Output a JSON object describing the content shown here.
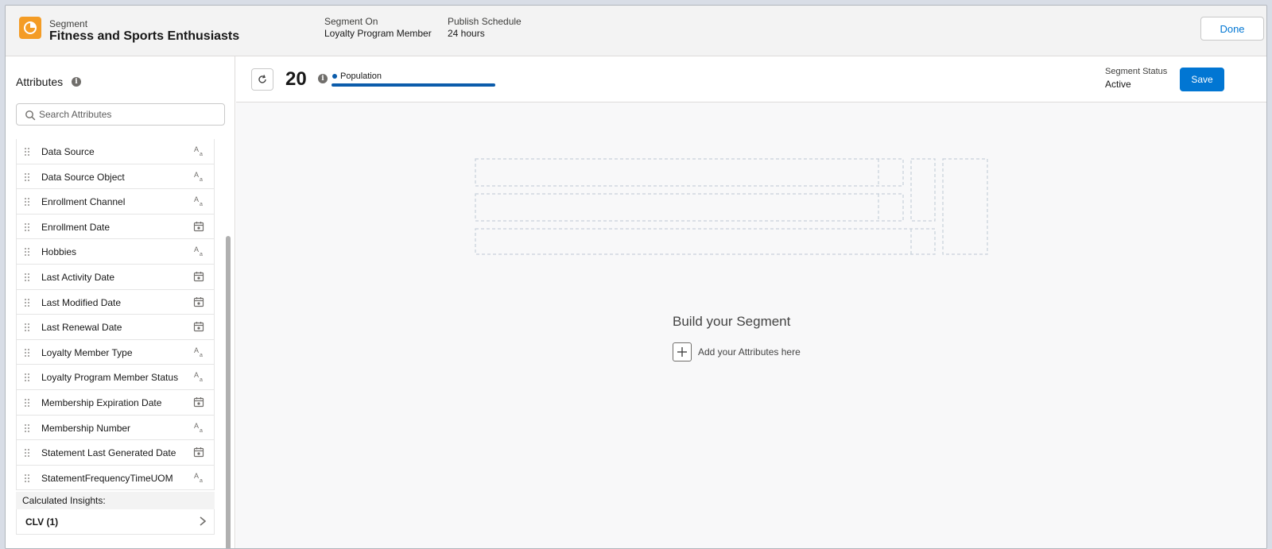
{
  "header": {
    "type_label": "Segment",
    "segment_name": "Fitness and Sports Enthusiasts",
    "segment_on_label": "Segment On",
    "segment_on_value": "Loyalty Program Member",
    "publish_label": "Publish Schedule",
    "publish_value": "24 hours",
    "done_label": "Done"
  },
  "sidebar": {
    "title": "Attributes",
    "search_placeholder": "Search Attributes",
    "items": [
      {
        "label": "Data Source",
        "type": "text"
      },
      {
        "label": "Data Source Object",
        "type": "text"
      },
      {
        "label": "Enrollment Channel",
        "type": "text"
      },
      {
        "label": "Enrollment Date",
        "type": "date"
      },
      {
        "label": "Hobbies",
        "type": "text"
      },
      {
        "label": "Last Activity Date",
        "type": "date"
      },
      {
        "label": "Last Modified Date",
        "type": "date"
      },
      {
        "label": "Last Renewal Date",
        "type": "date"
      },
      {
        "label": "Loyalty Member Type",
        "type": "text"
      },
      {
        "label": "Loyalty Program Member Status",
        "type": "text"
      },
      {
        "label": "Membership Expiration Date",
        "type": "date"
      },
      {
        "label": "Membership Number",
        "type": "text"
      },
      {
        "label": "Statement Last Generated Date",
        "type": "date"
      },
      {
        "label": "StatementFrequencyTimeUOM",
        "type": "text"
      }
    ],
    "calculated_header": "Calculated Insights:",
    "calculated_items": [
      {
        "label": "CLV (1)"
      }
    ]
  },
  "toolbar": {
    "population_count": "20",
    "population_label": "Population",
    "status_label": "Segment Status",
    "status_value": "Active",
    "save_label": "Save"
  },
  "canvas": {
    "title": "Build your Segment",
    "add_label": "Add your Attributes here"
  },
  "colors": {
    "brand": "#0176d3",
    "segment_icon": "#f49c25",
    "population_bar": "#0b5cab"
  }
}
